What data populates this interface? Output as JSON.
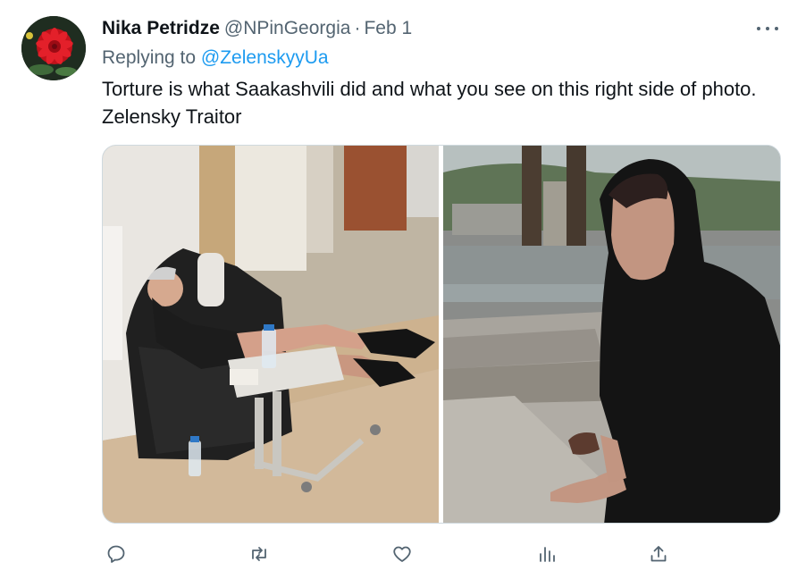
{
  "tweet": {
    "author": {
      "display_name": "Nika Petridze",
      "handle": "@NPinGeorgia",
      "avatar_icon": "red-flower-avatar"
    },
    "separator": "·",
    "date": "Feb 1",
    "replying_prefix": "Replying to ",
    "replying_to": "@ZelenskyyUa",
    "text": "Torture is what Saakashvili did and what you see on this right side of photo. Zelensky Traitor",
    "media": [
      {
        "icon": "photo-man-in-armchair"
      },
      {
        "icon": "photo-woman-in-black-hood"
      }
    ],
    "more_icon": "more-dots-icon",
    "actions": [
      {
        "icon": "reply-icon"
      },
      {
        "icon": "retweet-icon"
      },
      {
        "icon": "like-icon"
      },
      {
        "icon": "views-icon"
      },
      {
        "icon": "share-icon"
      }
    ],
    "colors": {
      "link": "#1d9bf0",
      "secondary_text": "#536471",
      "primary_text": "#0f1419"
    }
  }
}
